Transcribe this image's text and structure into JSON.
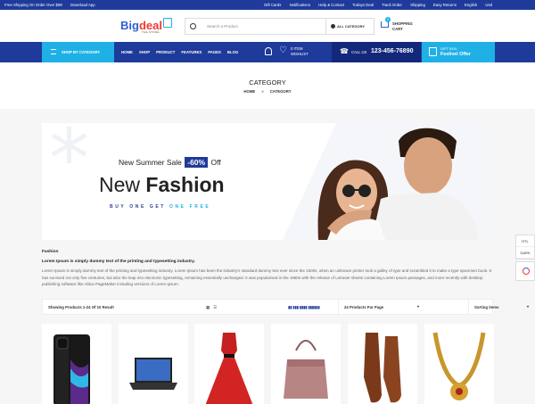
{
  "topbar": {
    "left": [
      "Free Shipping On Order Over $99",
      "Download App"
    ],
    "right": [
      "Gift Cards",
      "Notifications",
      "Help & Contact",
      "Todays Deal",
      "Track Order",
      "Shipping",
      "Easy Returns",
      "English",
      "Usd"
    ]
  },
  "header": {
    "logo_main": "Big",
    "logo_accent": "deal",
    "logo_sub": "THE STORE",
    "search_placeholder": "Search a Product",
    "category_label": "ALL CATEGORY",
    "cart_count": "0",
    "cart_line1": "SHOPPING",
    "cart_line2": "CART"
  },
  "nav": {
    "shop_by_category": "SHOP BY CATEGORY",
    "menu": [
      "HOME",
      "SHOP",
      "PRODUCT",
      "FEATURES",
      "PAGES",
      "BLOG"
    ],
    "wishlist_count": "0 ITEM",
    "wishlist_label": "WISHLIST",
    "call_label": "CALL US",
    "phone": "123-456-76890",
    "gift_line1": "GIFT BOX",
    "gift_line2": "Festivel Offer"
  },
  "breadcrumb": {
    "title": "CATEGORY",
    "home": "HOME",
    "current": "CATEGORY"
  },
  "banner": {
    "sale_text": "New Summer Sale",
    "discount": "-60%",
    "off": "Off",
    "headline_light": "New",
    "headline_bold": "Fashion",
    "bogo": "BUY ONE GET",
    "bogo_free": "ONE FREE"
  },
  "content": {
    "heading": "Fashion",
    "subheading": "Lorem Ipsum is simply dummy text of the printing and typesetting industry.",
    "description": "Lorem Ipsum is simply dummy text of the printing and typesetting industry. Lorem Ipsum has been the industry's standard dummy text ever since the 1500s, when an unknown printer took a galley of type and scrambled it to make a type specimen book. It has survived not only five centuries, but also the leap into electronic typesetting, remaining essentially unchanged. It was popularised in the 1960s with the release of Letraset sheets containing Lorem Ipsum passages, and more recently with desktop publishing software like Aldus PageMaker including versions of Lorem Ipsum."
  },
  "toolbar": {
    "result_text": "Showing Products 1-24 Of 10 Result",
    "per_page": "24 Products Par Page",
    "sort": "Sorting items"
  },
  "side_tools": {
    "rtl": "RTL",
    "dark": "DARK"
  },
  "products": [
    {
      "name": "smartphone"
    },
    {
      "name": "laptop"
    },
    {
      "name": "red-dress"
    },
    {
      "name": "handbag"
    },
    {
      "name": "brown-shoes"
    },
    {
      "name": "gold-necklace"
    }
  ],
  "colors": {
    "primary": "#1e3a9a",
    "accent": "#1fb1e6",
    "logo_red": "#f2382e"
  }
}
